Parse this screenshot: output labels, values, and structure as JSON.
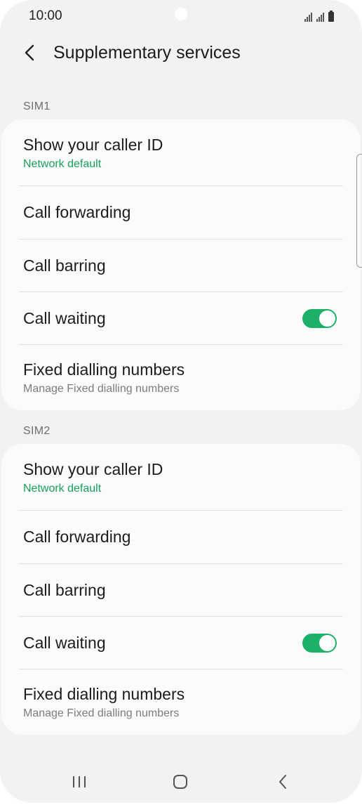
{
  "status_bar": {
    "time": "10:00"
  },
  "header": {
    "title": "Supplementary services"
  },
  "sections": [
    {
      "label": "SIM1",
      "rows": [
        {
          "title": "Show your caller ID",
          "subtitle": "Network default"
        },
        {
          "title": "Call forwarding"
        },
        {
          "title": "Call barring"
        },
        {
          "title": "Call waiting",
          "toggle_on": true
        },
        {
          "title": "Fixed dialling numbers",
          "subtitle": "Manage Fixed dialling numbers"
        }
      ]
    },
    {
      "label": "SIM2",
      "rows": [
        {
          "title": "Show your caller ID",
          "subtitle": "Network default"
        },
        {
          "title": "Call forwarding"
        },
        {
          "title": "Call barring"
        },
        {
          "title": "Call waiting",
          "toggle_on": true
        },
        {
          "title": "Fixed dialling numbers",
          "subtitle": "Manage Fixed dialling numbers"
        }
      ]
    }
  ],
  "colors": {
    "accent_green": "#1db068",
    "subtitle_green": "#16a05a",
    "background": "#f2f2f2",
    "card": "#fbfbfb"
  },
  "icons": {
    "back": "chevron-left-icon",
    "status": [
      "signal-sim1-icon",
      "signal-sim2-icon",
      "battery-icon"
    ],
    "nav": [
      "recent-apps-icon",
      "home-icon",
      "nav-back-icon"
    ]
  }
}
